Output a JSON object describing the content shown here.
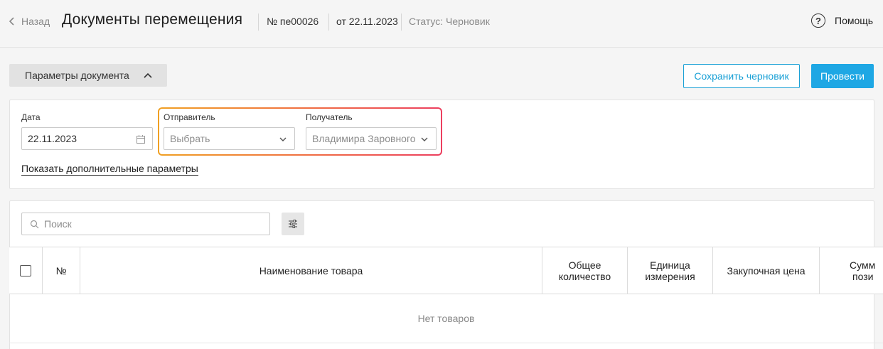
{
  "header": {
    "back_label": "Назад",
    "title": "Документы перемещения",
    "doc_number": "№ пе00026",
    "doc_date": "от 22.11.2023",
    "status": "Статус: Черновик",
    "help_label": "Помощь",
    "help_icon": "question-circle-icon"
  },
  "toolbar": {
    "params_toggle_label": "Параметры документа",
    "save_draft_label": "Сохранить черновик",
    "post_label": "Провести",
    "accent_color": "#1ea7e4"
  },
  "params": {
    "date_label": "Дата",
    "date_value": "22.11.2023",
    "sender_label": "Отправитель",
    "sender_placeholder": "Выбрать",
    "receiver_label": "Получатель",
    "receiver_value": "Владимира Заровного",
    "more_link": "Показать дополнительные параметры",
    "highlight_colors": [
      "#f0a023",
      "#ec3f5f"
    ]
  },
  "goods": {
    "search_placeholder": "Поиск",
    "columns": [
      "№",
      "Наименование товара",
      "Общее количество",
      "Единица измерения",
      "Закупочная цена",
      "Сумма позиции"
    ],
    "column_lines": [
      [
        "Общее",
        "количество"
      ],
      [
        "Единица",
        "измерения"
      ],
      [
        "Сумм",
        "пози"
      ]
    ],
    "empty_text": "Нет товаров"
  }
}
